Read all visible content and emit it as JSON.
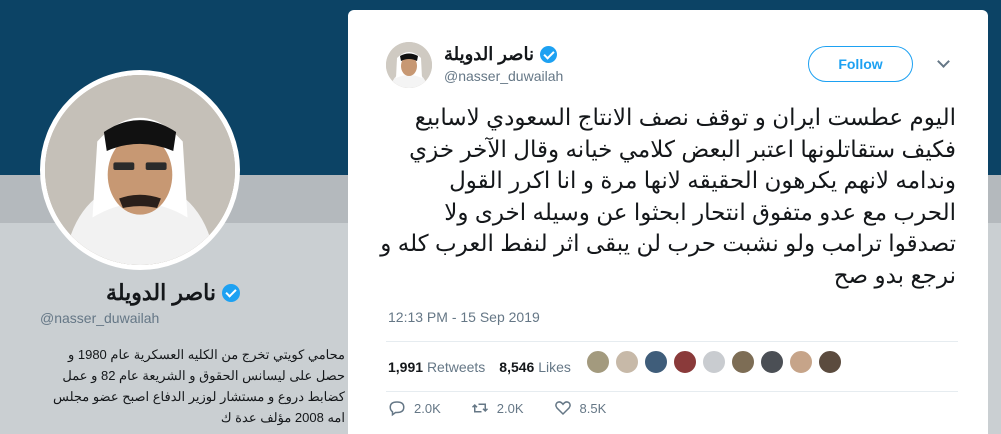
{
  "profile": {
    "name": "ناصر الدويلة",
    "handle": "@nasser_duwailah",
    "bio": "محامي كويتي تخرج من الكليه العسكرية عام 1980 و حصل على ليسانس الحقوق و الشريعة عام 82 و عمل كضابط دروع و مستشار لوزير الدفاع اصبح عضو مجلس امه 2008 مؤلف عدة ك"
  },
  "tweet": {
    "author_name": "ناصر الدويلة",
    "author_handle": "@nasser_duwailah",
    "follow_label": "Follow",
    "lines": [
      "اليوم عطست ايران و توقف نصف الانتاج السعودي لاسابيع",
      "فكيف ستقاتلونها اعتبر البعض كلامي خيانه وقال الآخر خزي",
      "وندامه لانهم يكرهون الحقيقه لانها مرة و انا اكرر القول",
      "الحرب مع عدو متفوق انتحار ابحثوا عن وسيله اخرى ولا",
      "تصدقوا ترامب ولو نشبت حرب لن يبقى اثر لنفط العرب كله و",
      "نرجع بدو صح"
    ],
    "timestamp": "12:13 PM - 15 Sep 2019",
    "retweets_count": "1,991",
    "retweets_label": "Retweets",
    "likes_count": "8,546",
    "likes_label": "Likes",
    "reply_count": "2.0K",
    "retweet_count_short": "2.0K",
    "like_count_short": "8.5K"
  },
  "icons": {
    "verified": "verified-badge-icon",
    "reply": "reply-icon",
    "retweet": "retweet-icon",
    "like": "heart-icon",
    "caret": "chevron-down-icon"
  },
  "colors": {
    "accent": "#1da1f2",
    "secondary_text": "#657786",
    "primary_text": "#14171a"
  },
  "liker_colors": [
    "#a39a7e",
    "#c7b9a8",
    "#3f5d7a",
    "#8a3a3a",
    "#c9ccd0",
    "#7d6d55",
    "#4b4f55",
    "#c6a489",
    "#5b4b3e"
  ]
}
